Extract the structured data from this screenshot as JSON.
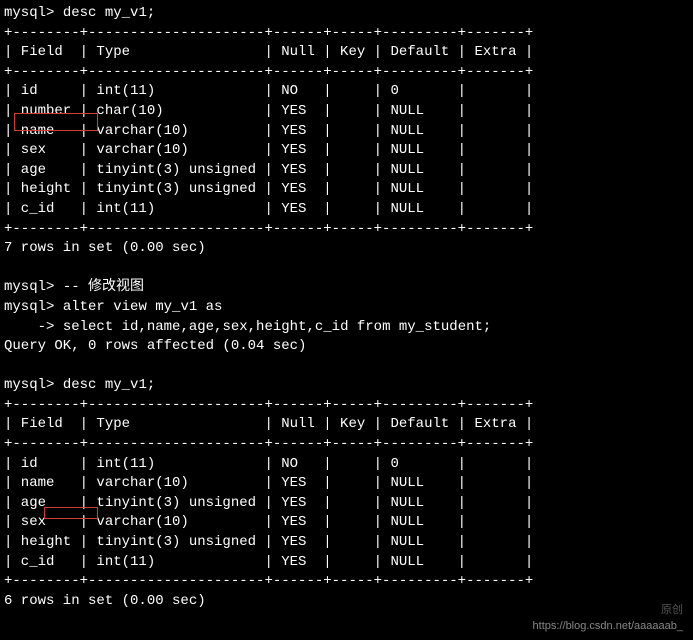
{
  "prompt": "mysql>",
  "cont_prompt": "    ->",
  "commands": {
    "desc1": "desc my_v1;",
    "comment": "-- 修改视图",
    "alter1": "alter view my_v1 as",
    "alter2": "select id,name,age,sex,height,c_id from my_student;",
    "query_ok": "Query OK, 0 rows affected (0.04 sec)",
    "desc2": "desc my_v1;",
    "rows1": "7 rows in set (0.00 sec)",
    "rows2": "6 rows in set (0.00 sec)"
  },
  "table_border": "+--------+---------------------+------+-----+---------+-------+",
  "table_header": "| Field  | Type                | Null | Key | Default | Extra |",
  "table1_rows": [
    "| id     | int(11)             | NO   |     | 0       |       |",
    "| number | char(10)            | YES  |     | NULL    |       |",
    "| name   | varchar(10)         | YES  |     | NULL    |       |",
    "| sex    | varchar(10)         | YES  |     | NULL    |       |",
    "| age    | tinyint(3) unsigned | YES  |     | NULL    |       |",
    "| height | tinyint(3) unsigned | YES  |     | NULL    |       |",
    "| c_id   | int(11)             | YES  |     | NULL    |       |"
  ],
  "table2_rows": [
    "| id     | int(11)             | NO   |     | 0       |       |",
    "| name   | varchar(10)         | YES  |     | NULL    |       |",
    "| age    | tinyint(3) unsigned | YES  |     | NULL    |       |",
    "| sex    | varchar(10)         | YES  |     | NULL    |       |",
    "| height | tinyint(3) unsigned | YES  |     | NULL    |       |",
    "| c_id   | int(11)             | YES  |     | NULL    |       |"
  ],
  "watermark": "https://blog.csdn.net/aaaaaab_",
  "watermark2": "原创"
}
